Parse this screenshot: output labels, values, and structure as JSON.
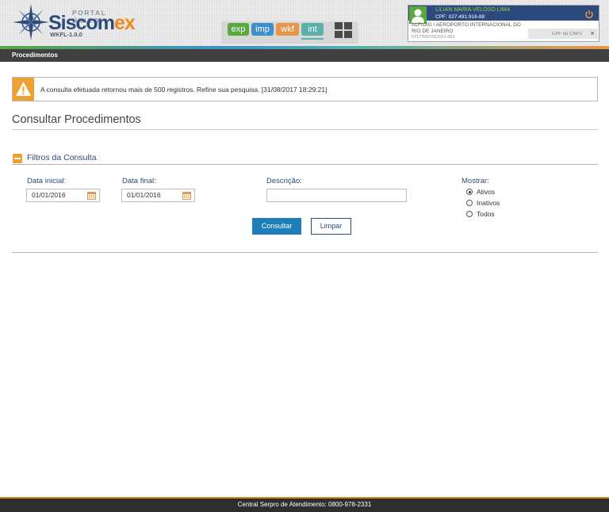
{
  "header": {
    "portal_label": "PORTAL ÚNICO",
    "brand_main": "Siscom",
    "brand_accent": "ex",
    "version": "WKFL-1.0.0",
    "modules": [
      {
        "label": "exp",
        "color": "#5aa83e"
      },
      {
        "label": "imp",
        "color": "#3c8fc8"
      },
      {
        "label": "wkf",
        "color": "#e8954a"
      },
      {
        "label": "int",
        "color": "#5ab0a8"
      }
    ],
    "grid_icon": "grid-icon"
  },
  "user": {
    "name": "LILIAN MARIA VELOSO LIMA",
    "cpf": "CPF: 027.491.916-88",
    "unit": "ALF/GIG / AEROPORTO INTERNACIONAL DO RIO DE JANEIRO",
    "code": "0717700/7911101-001",
    "cpf_placeholder": "CPF ou CNPJ",
    "close_label": "×"
  },
  "nav": {
    "breadcrumb": "Procedimentos"
  },
  "alert": {
    "icon": "warning-icon",
    "message": "A consulta efetuada retornou mais de 500 registros. Refine sua pesquisa. [31/08/2017 18:29:21]"
  },
  "page": {
    "title": "Consultar Procedimentos"
  },
  "filters": {
    "section_title": "Filtros da Consulta",
    "start_date_label": "Data inicial:",
    "start_date_value": "01/01/2016",
    "end_date_label": "Data final:",
    "end_date_value": "01/01/2016",
    "description_label": "Descrição:",
    "description_value": "",
    "show_label": "Mostrar:",
    "show_options": [
      {
        "label": "Ativos",
        "selected": true
      },
      {
        "label": "Inativos",
        "selected": false
      },
      {
        "label": "Todos",
        "selected": false
      }
    ]
  },
  "actions": {
    "search_label": "Consultar",
    "clear_label": "Limpar"
  },
  "footer": {
    "text": "Central Serpro de Atendimento: 0800-978-2331"
  },
  "colors": {
    "brand_blue": "#2d4a7c",
    "accent_orange": "#f0a030",
    "primary_button": "#1e7fb8"
  }
}
